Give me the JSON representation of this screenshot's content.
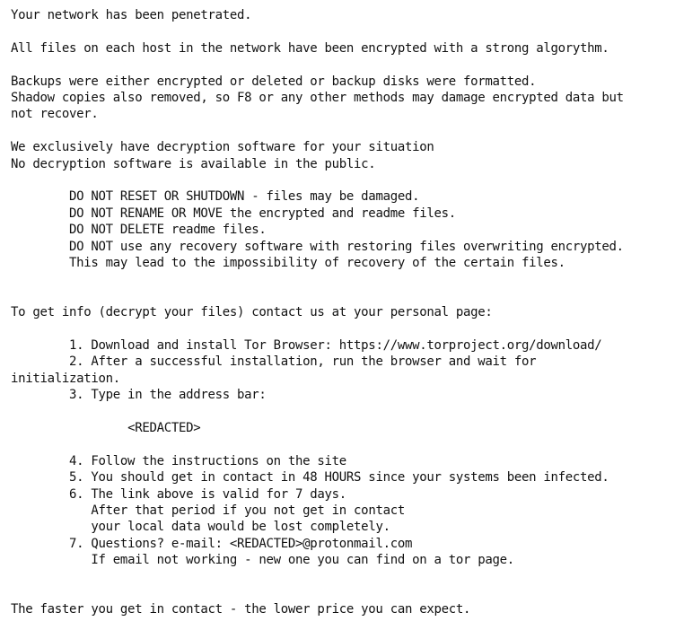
{
  "note": {
    "lines": [
      "Your network has been penetrated.",
      "",
      "All files on each host in the network have been encrypted with a strong algorythm.",
      "",
      "Backups were either encrypted or deleted or backup disks were formatted.",
      "Shadow copies also removed, so F8 or any other methods may damage encrypted data but",
      "not recover.",
      "",
      "We exclusively have decryption software for your situation",
      "No decryption software is available in the public.",
      "",
      "        DO NOT RESET OR SHUTDOWN - files may be damaged.",
      "        DO NOT RENAME OR MOVE the encrypted and readme files.",
      "        DO NOT DELETE readme files.",
      "        DO NOT use any recovery software with restoring files overwriting encrypted.",
      "        This may lead to the impossibility of recovery of the certain files.",
      "",
      "",
      "To get info (decrypt your files) contact us at your personal page:",
      "",
      "        1. Download and install Tor Browser: https://www.torproject.org/download/",
      "        2. After a successful installation, run the browser and wait for",
      "initialization.",
      "        3. Type in the address bar:",
      "",
      "                <REDACTED>",
      "",
      "        4. Follow the instructions on the site",
      "        5. You should get in contact in 48 HOURS since your systems been infected.",
      "        6. The link above is valid for 7 days.",
      "           After that period if you not get in contact",
      "           your local data would be lost completely.",
      "        7. Questions? e-mail: <REDACTED>@protonmail.com",
      "           If email not working - new one you can find on a tor page.",
      "",
      "",
      "The faster you get in contact - the lower price you can expect."
    ]
  }
}
